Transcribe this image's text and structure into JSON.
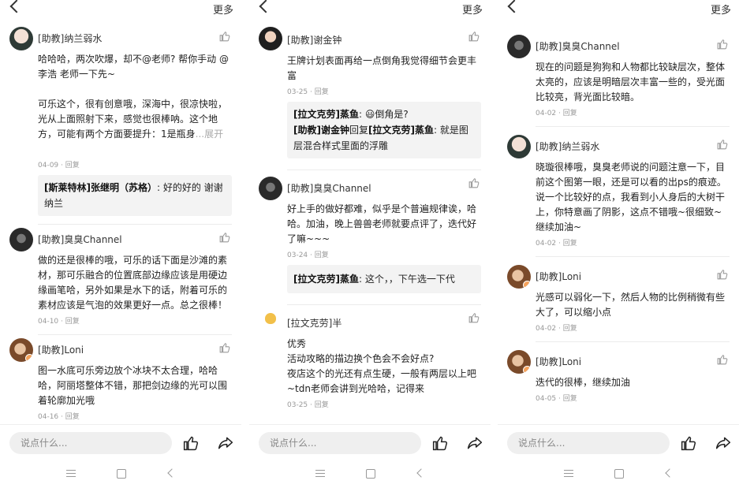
{
  "header": {
    "more_label": "更多"
  },
  "composer": {
    "placeholder": "说点什么..."
  },
  "panels": [
    {
      "comments": [
        {
          "name": "[助教]纳兰弱水",
          "text": "哈哈哈，两次吹爆，却不@老师? 帮你手动 @李浩 老师一下先~\n\n可乐这个，很有创意哦，深海中，很凉快啦，光从上面照射下来，感觉也很棒呐。这个地方，可能有两个方面要提升：1是瓶身",
          "more": "...展开",
          "date": "04-09",
          "reply_label": "回复",
          "replies": [
            {
              "author": "[斯莱特林]张继明（苏格）",
              "text": ": 好的好的  谢谢纳兰"
            }
          ]
        },
        {
          "name": "[助教]臭臭Channel",
          "text": "做的还是很棒的哦，可乐的话下面是沙滩的素材，那可乐融合的位置底部边缘应该是用硬边缘画笔哈，另外如果是水下的话，附着可乐的素材应该是气泡的效果更好一点。总之很棒！",
          "date": "04-10",
          "reply_label": "回复"
        },
        {
          "name": "[助教]Loni",
          "text": "图一水底可乐旁边放个冰块不太合理，哈哈哈，阿丽塔整体不错，那把剑边缘的光可以围着轮廓加光哦",
          "date": "04-16",
          "reply_label": "回复"
        }
      ]
    },
    {
      "comments": [
        {
          "name": "[助教]谢金钟",
          "text": "王牌计划表面再给一点倒角我觉得细节会更丰富",
          "date": "03-25",
          "reply_label": "回复",
          "replies": [
            {
              "author": "[拉文克劳]蒸鱼",
              "text": ": 😃倒角是?"
            },
            {
              "author": "[助教]谢金钟",
              "mid": "回复",
              "author2": "[拉文克劳]蒸鱼",
              "text": ": 就是图层混合样式里面的浮雕"
            }
          ]
        },
        {
          "name": "[助教]臭臭Channel",
          "text": "好上手的做好都难，似乎是个普遍规律诶，哈哈。加油，晚上兽兽老师就要点评了，迭代好了嘛~~~",
          "date": "03-24",
          "reply_label": "回复",
          "replies": [
            {
              "author": "[拉文克劳]蒸鱼",
              "text": ": 这个，，下午选一下代"
            }
          ]
        },
        {
          "name": "[拉文克劳]半",
          "text": "优秀\n活动攻略的描边换个色会不会好点?\n夜店这个的光还有点生硬，一般有两层以上吧~tdn老师会讲到光哈哈，记得来",
          "date": "03-25",
          "reply_label": "回复"
        }
      ]
    },
    {
      "comments": [
        {
          "name": "[助教]臭臭Channel",
          "text": "现在的问题是狗狗和人物都比较缺层次，整体太亮的，应该是明暗层次丰富一些的，受光面比较亮，背光面比较暗。",
          "date": "04-02",
          "reply_label": "回复"
        },
        {
          "name": "[助教]纳兰弱水",
          "text": "晓璇很棒哦，臭臭老师说的问题注意一下，目前这个图第一眼，还是可以看的出ps的痕迹。说一个比较好的点，我看到小人身后的大树干上，你特意画了阴影，这点不错哦~很细致~继续加油~",
          "date": "04-02",
          "reply_label": "回复"
        },
        {
          "name": "[助教]Loni",
          "text": "光感可以弱化一下，然后人物的比例稍微有些大了，可以缩小点",
          "date": "04-02",
          "reply_label": "回复"
        },
        {
          "name": "[助教]Loni",
          "text": "迭代的很棒，继续加油",
          "date": "04-05",
          "reply_label": "回复"
        }
      ]
    }
  ]
}
